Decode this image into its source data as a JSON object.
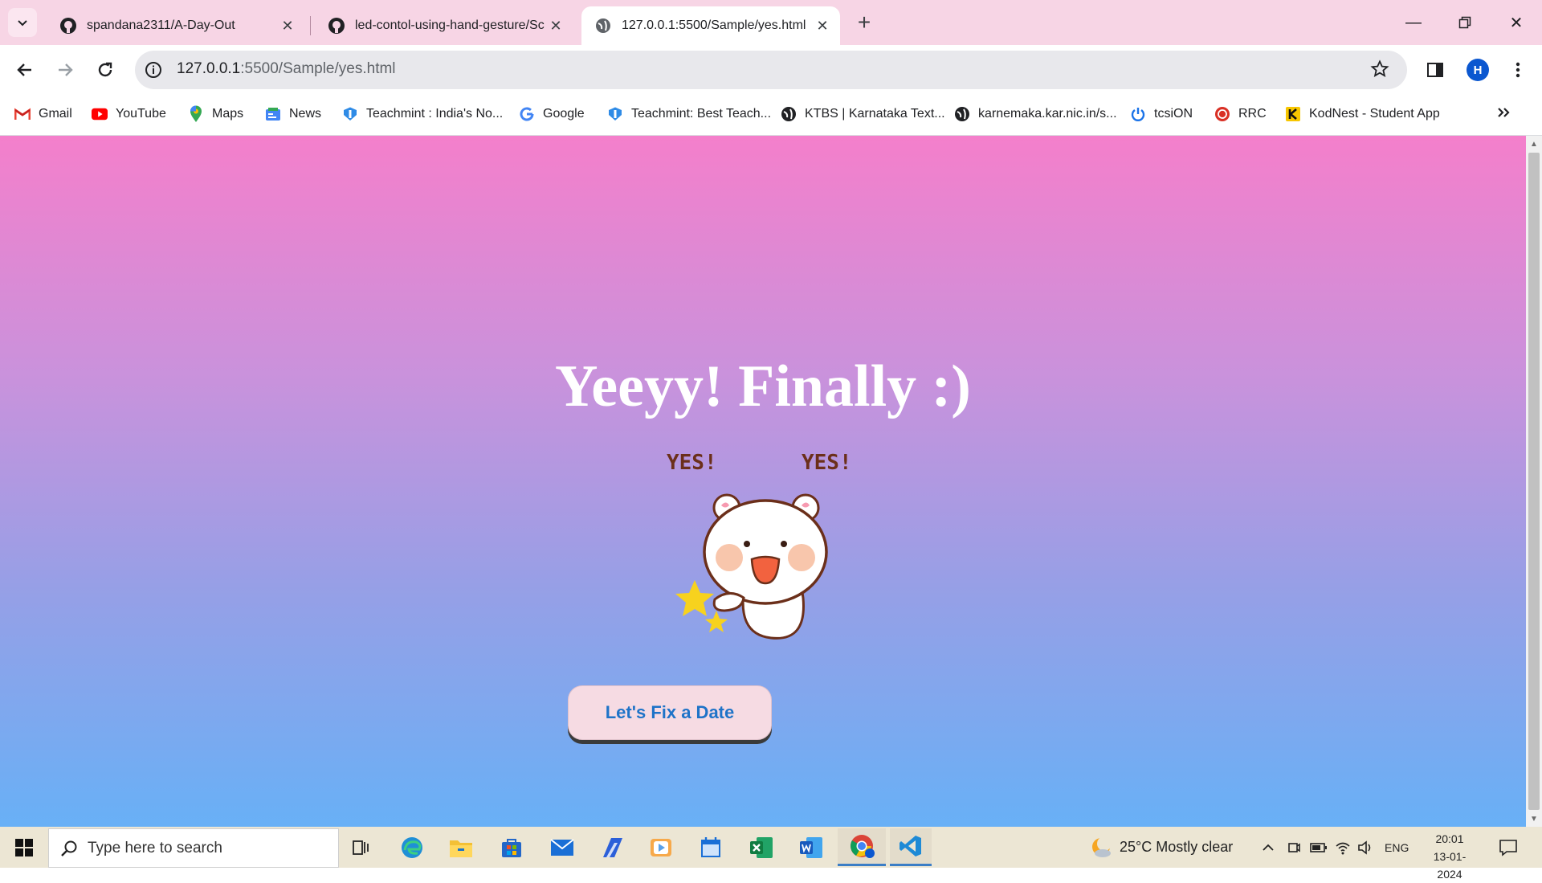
{
  "browser": {
    "tabs": [
      {
        "title": "spandana2311/A-Day-Out",
        "icon": "github-icon",
        "active": false
      },
      {
        "title": "led-contol-using-hand-gesture/Sc",
        "icon": "github-icon",
        "active": false
      },
      {
        "title": "127.0.0.1:5500/Sample/yes.html",
        "icon": "globe-icon",
        "active": true
      }
    ],
    "address": {
      "host": "127.0.0.1",
      "rest": ":5500/Sample/yes.html"
    },
    "profile_initial": "H",
    "bookmarks": [
      {
        "label": "Gmail",
        "icon": "gmail-icon"
      },
      {
        "label": "YouTube",
        "icon": "youtube-icon"
      },
      {
        "label": "Maps",
        "icon": "maps-icon"
      },
      {
        "label": "News",
        "icon": "news-icon"
      },
      {
        "label": "Teachmint : India's No...",
        "icon": "teachmint-icon"
      },
      {
        "label": "Google",
        "icon": "google-icon"
      },
      {
        "label": "Teachmint: Best Teach...",
        "icon": "teachmint-icon"
      },
      {
        "label": "KTBS | Karnataka Text...",
        "icon": "globe-icon"
      },
      {
        "label": "karnemaka.kar.nic.in/s...",
        "icon": "globe-icon"
      },
      {
        "label": "tcsiON",
        "icon": "power-icon"
      },
      {
        "label": "RRC",
        "icon": "rrc-icon"
      },
      {
        "label": "KodNest - Student App",
        "icon": "kodnest-icon"
      }
    ]
  },
  "page": {
    "headline": "Yeeyy! Finally :)",
    "gif_text_left": "YES!",
    "gif_text_right": "YES!",
    "cta_label": "Let's Fix a Date"
  },
  "taskbar": {
    "search_placeholder": "Type here to search",
    "weather": "25°C  Mostly clear",
    "language": "ENG",
    "time": "20:01",
    "date": "13-01-2024"
  },
  "colors": {
    "page_gradient_top": "#f47fcb",
    "page_gradient_bottom": "#68b0f6",
    "cta_text": "#1e73c8",
    "tabstrip": "#f7d5e5"
  }
}
